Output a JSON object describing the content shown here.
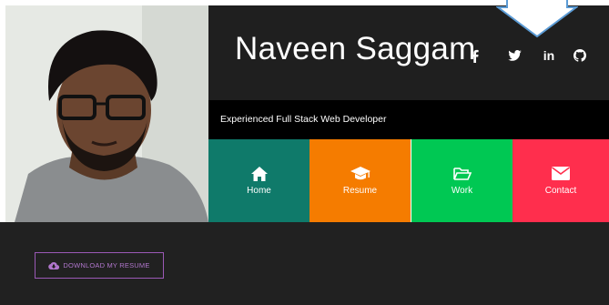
{
  "profile": {
    "name": "Naveen Saggam",
    "tagline": "Experienced Full Stack Web Developer"
  },
  "social": [
    {
      "icon": "facebook-icon",
      "glyph": "f"
    },
    {
      "icon": "twitter-icon"
    },
    {
      "icon": "linkedin-icon",
      "glyph": "in"
    },
    {
      "icon": "github-icon"
    }
  ],
  "nav": [
    {
      "label": "Home",
      "icon": "home-icon",
      "color": "#0f7a6a"
    },
    {
      "label": "Resume",
      "icon": "graduation-cap-icon",
      "color": "#f57c00"
    },
    {
      "label": "Work",
      "icon": "folder-open-icon",
      "color": "#00c853"
    },
    {
      "label": "Contact",
      "icon": "envelope-icon",
      "color": "#ff2e4d"
    }
  ],
  "download": {
    "label": "DOWNLOAD MY RESUME",
    "icon": "cloud-download-icon",
    "color": "#9b59b6"
  },
  "annotation": {
    "icon": "arrow-down-icon",
    "color": "#5b9bd5"
  }
}
